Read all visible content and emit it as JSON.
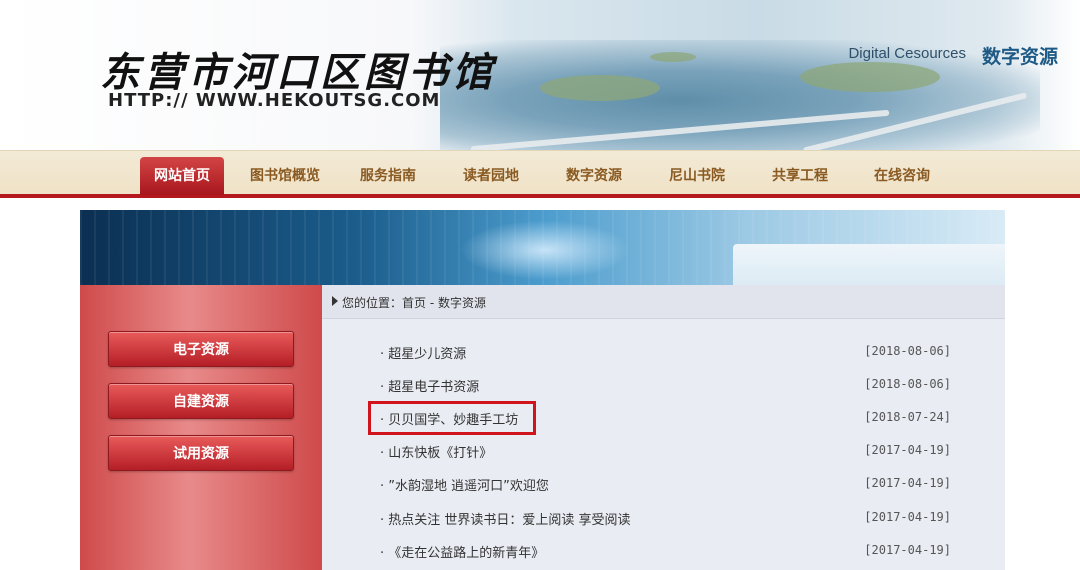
{
  "header": {
    "logo_title": "东营市河口区图书馆",
    "logo_url": "HTTP:// WWW.HEKOUTSG.COM"
  },
  "nav": {
    "items": [
      {
        "label": "网站首页",
        "active": true
      },
      {
        "label": "图书馆概览"
      },
      {
        "label": "服务指南"
      },
      {
        "label": "读者园地"
      },
      {
        "label": "数字资源"
      },
      {
        "label": "尼山书院"
      },
      {
        "label": "共享工程"
      },
      {
        "label": "在线咨询"
      }
    ]
  },
  "banner": {
    "english": "Digital Cesources",
    "chinese": "数字资源"
  },
  "sidebar": {
    "items": [
      {
        "label": "电子资源"
      },
      {
        "label": "自建资源"
      },
      {
        "label": "试用资源"
      }
    ]
  },
  "breadcrumb": "您的位置：首页 - 数字资源",
  "list": [
    {
      "title": "· 超星少儿资源",
      "date": "[2018-08-06]"
    },
    {
      "title": "· 超星电子书资源",
      "date": "[2018-08-06]"
    },
    {
      "title": "· 贝贝国学、妙趣手工坊",
      "date": "[2018-07-24]",
      "highlighted": true
    },
    {
      "title": "· 山东快板《打针》",
      "date": "[2017-04-19]"
    },
    {
      "title": "· ”水韵湿地 逍遥河口”欢迎您",
      "date": "[2017-04-19]"
    },
    {
      "title": "· 热点关注 世界读书日：爱上阅读 享受阅读",
      "date": "[2017-04-19]"
    },
    {
      "title": "· 《走在公益路上的新青年》",
      "date": "[2017-04-19]"
    }
  ],
  "colors": {
    "nav_red": "#b5171f",
    "nav_text": "#8a5a22",
    "highlight_border": "#d1141c"
  }
}
